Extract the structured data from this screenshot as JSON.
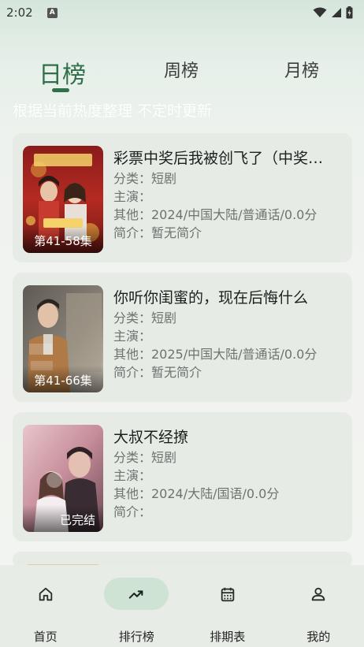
{
  "status": {
    "time": "2:02",
    "notification_icon": "A"
  },
  "tabs": [
    {
      "label": "日榜",
      "active": true
    },
    {
      "label": "周榜",
      "active": false
    },
    {
      "label": "月榜",
      "active": false
    }
  ],
  "subtitle": "根据当前热度整理 不定时更新",
  "items": [
    {
      "title": "彩票中奖后我被创飞了（中奖后被全家创飞了）",
      "category": "分类：短剧",
      "cast": "主演：",
      "other": "其他：2024/中国大陆/普通话/0.0分",
      "intro": "简介：暂无简介",
      "badge": "第41-58集"
    },
    {
      "title": "你听你闺蜜的，现在后悔什么",
      "category": "分类：短剧",
      "cast": "主演：",
      "other": "其他：2025/中国大陆/普通话/0.0分",
      "intro": "简介：暂无简介",
      "badge": "第41-66集"
    },
    {
      "title": "大叔不经撩",
      "category": "分类：短剧",
      "cast": "主演：",
      "other": "其他：2024/大陆/国语/0.0分",
      "intro": "简介：",
      "badge": "已完结"
    }
  ],
  "nav": [
    {
      "label": "首页",
      "icon": "home-icon",
      "active": false
    },
    {
      "label": "排行榜",
      "icon": "trending-icon",
      "active": true
    },
    {
      "label": "排期表",
      "icon": "calendar-icon",
      "active": false
    },
    {
      "label": "我的",
      "icon": "person-icon",
      "active": false
    }
  ],
  "colors": {
    "accent": "#2f6f4a",
    "card": "#e6ebe5",
    "nav_active": "#cfe3d5"
  }
}
